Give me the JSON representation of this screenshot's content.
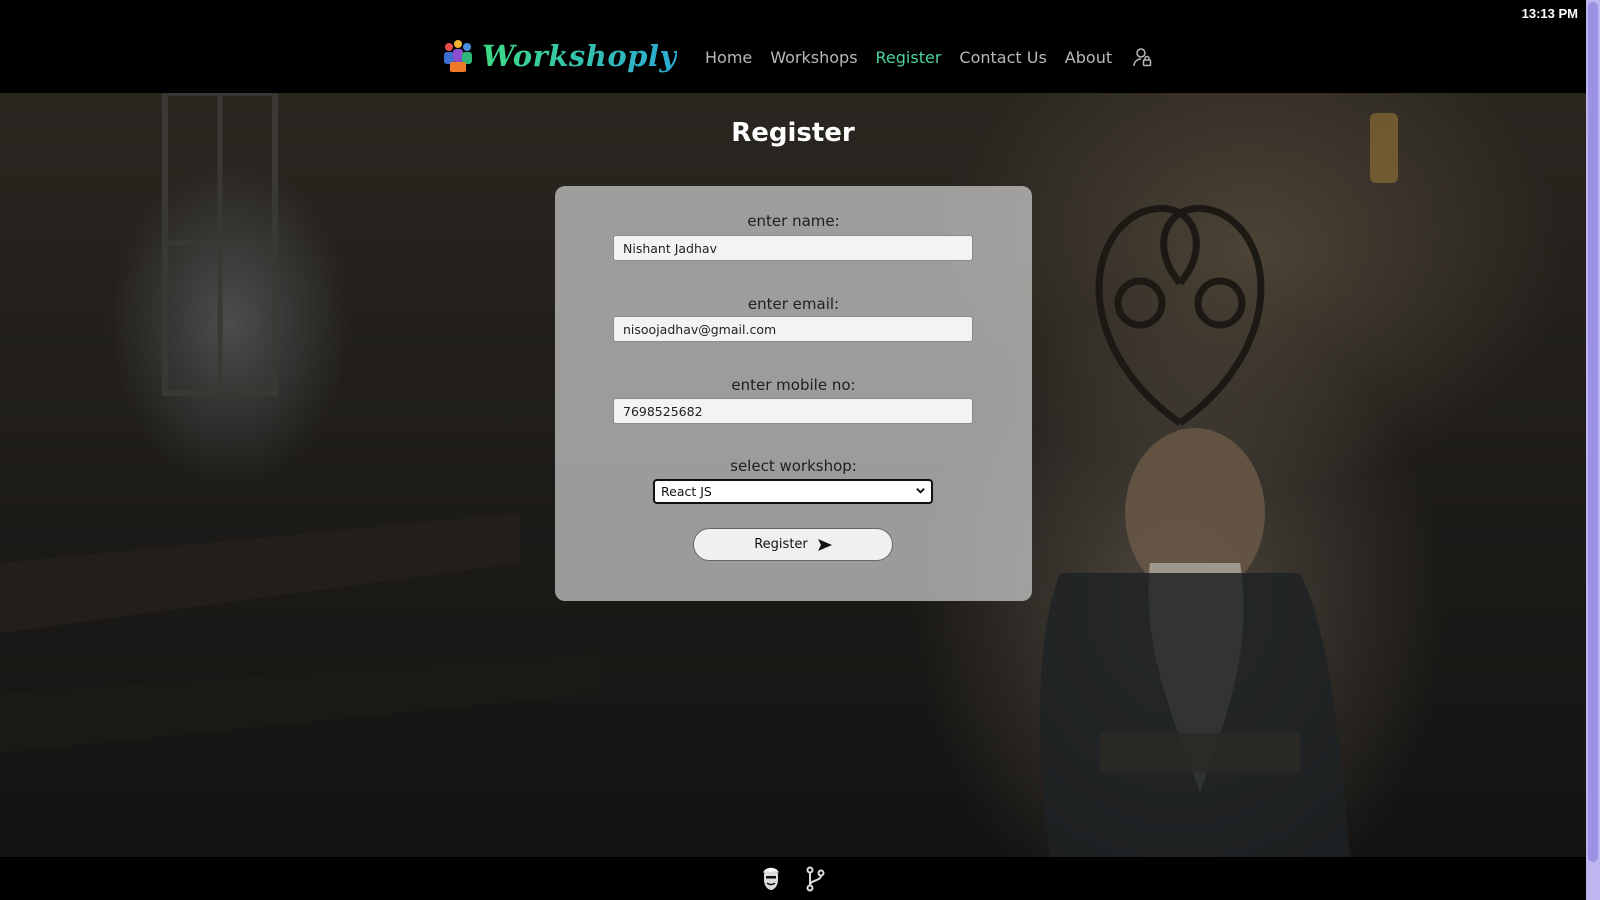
{
  "status_bar": {
    "time": "13:13 PM"
  },
  "brand": {
    "name": "Workshoply",
    "logo_icon": "workshop-people-icon"
  },
  "nav": {
    "items": [
      {
        "label": "Home",
        "active": false
      },
      {
        "label": "Workshops",
        "active": false
      },
      {
        "label": "Register",
        "active": true
      },
      {
        "label": "Contact Us",
        "active": false
      },
      {
        "label": "About",
        "active": false
      }
    ],
    "user_icon": "user-lock-icon",
    "active_color": "#4fd39a"
  },
  "page": {
    "title": "Register"
  },
  "form": {
    "name_label": "enter name:",
    "name_value": "Nishant Jadhav",
    "email_label": "enter email:",
    "email_value": "nisoojadhav@gmail.com",
    "mobile_label": "enter mobile no:",
    "mobile_value": "7698525682",
    "workshop_label": "select workshop:",
    "workshop_selected": "React JS",
    "submit_label": "Register",
    "submit_icon": "send-icon"
  },
  "footer": {
    "icons": [
      "developer-avatar-icon",
      "git-branch-icon"
    ]
  }
}
